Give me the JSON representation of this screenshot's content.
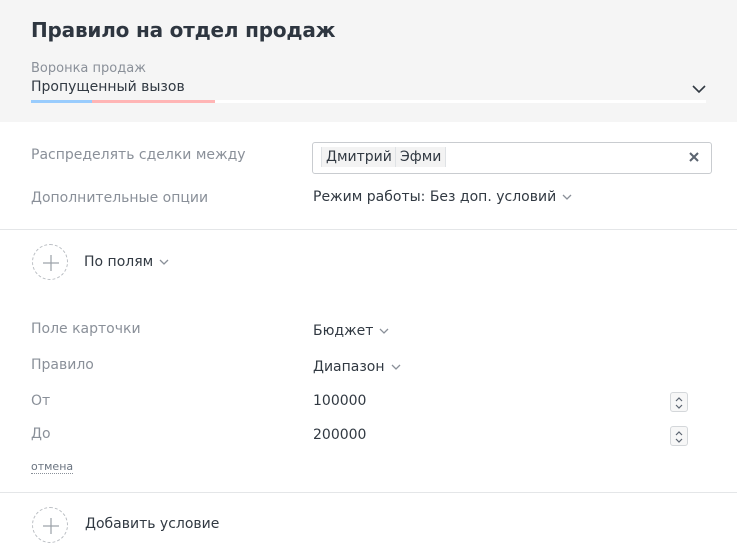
{
  "header": {
    "title": "Правило на отдел продаж",
    "pipeline_label": "Воронка продаж",
    "pipeline_value": "Пропущенный вызов"
  },
  "distribution": {
    "label": "Распределять сделки между",
    "users": [
      "Дмитрий",
      "Эфми"
    ],
    "clear_icon": "close-icon"
  },
  "options": {
    "label": "Дополнительные опции",
    "value": "Режим работы: Без доп. условий"
  },
  "by_fields": {
    "label": "По полям",
    "add_icon": "plus-icon"
  },
  "condition": {
    "field_label": "Поле карточки",
    "field_value": "Бюджет",
    "rule_label": "Правило",
    "rule_value": "Диапазон",
    "from_label": "От",
    "from_value": "100000",
    "to_label": "До",
    "to_value": "200000",
    "cancel": "отмена"
  },
  "add_condition": {
    "label": "Добавить условие",
    "add_icon": "plus-icon"
  },
  "colors": {
    "accent_blue": "#99ccfd",
    "accent_pink": "#ffb5b5",
    "header_bg": "#f5f5f5"
  }
}
